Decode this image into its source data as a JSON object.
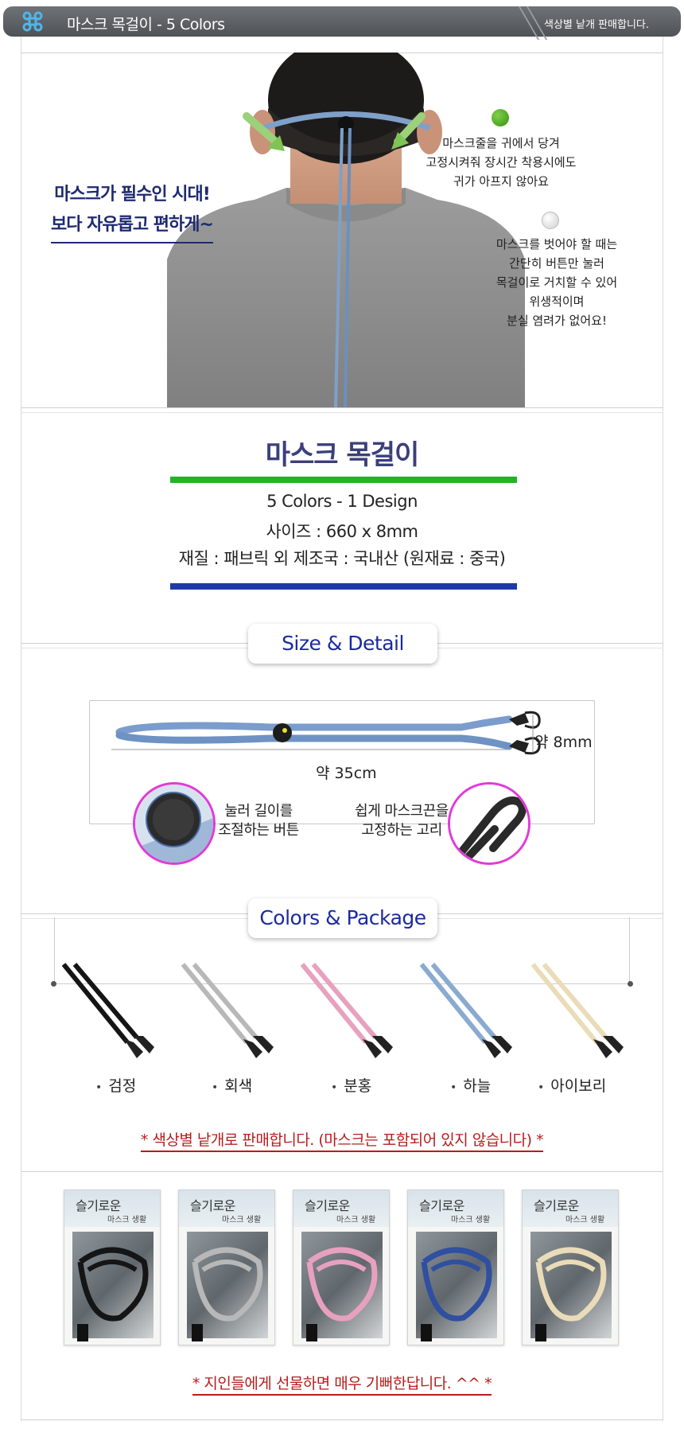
{
  "header": {
    "title": "마스크 목걸이 - 5 Colors",
    "note": "색상별 낱개 판매합니다."
  },
  "intro": {
    "slogan_line1": "마스크가 필수인 시대!",
    "slogan_line2": "보다 자유롭고 편하게~",
    "caption1": [
      "마스크줄을 귀에서 당겨",
      "고정시켜줘 장시간 착용시에도",
      "귀가 아프지 않아요"
    ],
    "caption2": [
      "마스크를 벗어야 할 때는",
      "간단히 버튼만 눌러",
      "목걸이로 거치할 수 있어",
      "위생적이며",
      "분실 염려가 없어요!"
    ]
  },
  "info": {
    "title": "마스크 목걸이",
    "spec1": "5 Colors - 1 Design",
    "spec2": "사이즈 : 660 x 8mm",
    "spec3": "재질 : 패브릭 외    제조국 : 국내산 (원재료 : 중국)"
  },
  "detail": {
    "label": "Size & Detail",
    "width_label": "약 8mm",
    "length_label": "약 35cm",
    "button_caption": [
      "눌러 길이를",
      "조절하는 버튼"
    ],
    "hook_caption": [
      "쉽게 마스크끈을",
      "고정하는 고리"
    ]
  },
  "colors": {
    "label": "Colors & Package",
    "items": [
      {
        "name": "검정",
        "color": "#151515"
      },
      {
        "name": "회색",
        "color": "#b8b8b8"
      },
      {
        "name": "분홍",
        "color": "#e7a1bf"
      },
      {
        "name": "하늘",
        "color": "#8aaad0"
      },
      {
        "name": "아이보리",
        "color": "#eadcb8"
      }
    ],
    "note": "* 색상별 낱개로 판매합니다. (마스크는 포함되어 있지 않습니다) *"
  },
  "packages": {
    "title": "슬기로운",
    "subtitle": "마스크 생활",
    "note": "* 지인들에게 선물하면 매우 기뻐한답니다. ^^ *"
  },
  "accent": {
    "green": "#22b32a",
    "blue": "#1f3aa8",
    "navy_text": "#1e2a70",
    "label_text": "#1a2aa0",
    "red_note": "#b71c1c",
    "magenta_ring": "#e23ad8"
  }
}
